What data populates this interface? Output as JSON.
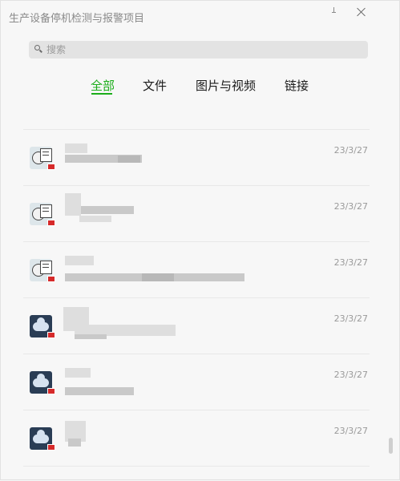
{
  "window": {
    "title": "生产设备停机检测与报警项目"
  },
  "search": {
    "placeholder": "搜索"
  },
  "tabs": [
    {
      "label": "全部",
      "active": true
    },
    {
      "label": "文件",
      "active": false
    },
    {
      "label": "图片与视频",
      "active": false
    },
    {
      "label": "链接",
      "active": false
    }
  ],
  "messages": [
    {
      "avatar": "meme-avatar-icon",
      "date": ""
    },
    {
      "avatar": "meme-avatar-icon",
      "date": "23/3/27"
    },
    {
      "avatar": "meme-avatar-icon",
      "date": "23/3/27"
    },
    {
      "avatar": "meme-avatar-icon",
      "date": "23/3/27"
    },
    {
      "avatar": "cloud-avatar-icon",
      "date": "23/3/27"
    },
    {
      "avatar": "cloud-avatar-icon",
      "date": "23/3/27"
    },
    {
      "avatar": "cloud-avatar-icon",
      "date": "23/3/27"
    }
  ],
  "colors": {
    "accent": "#1aad19",
    "flag": "#d62a2a"
  }
}
